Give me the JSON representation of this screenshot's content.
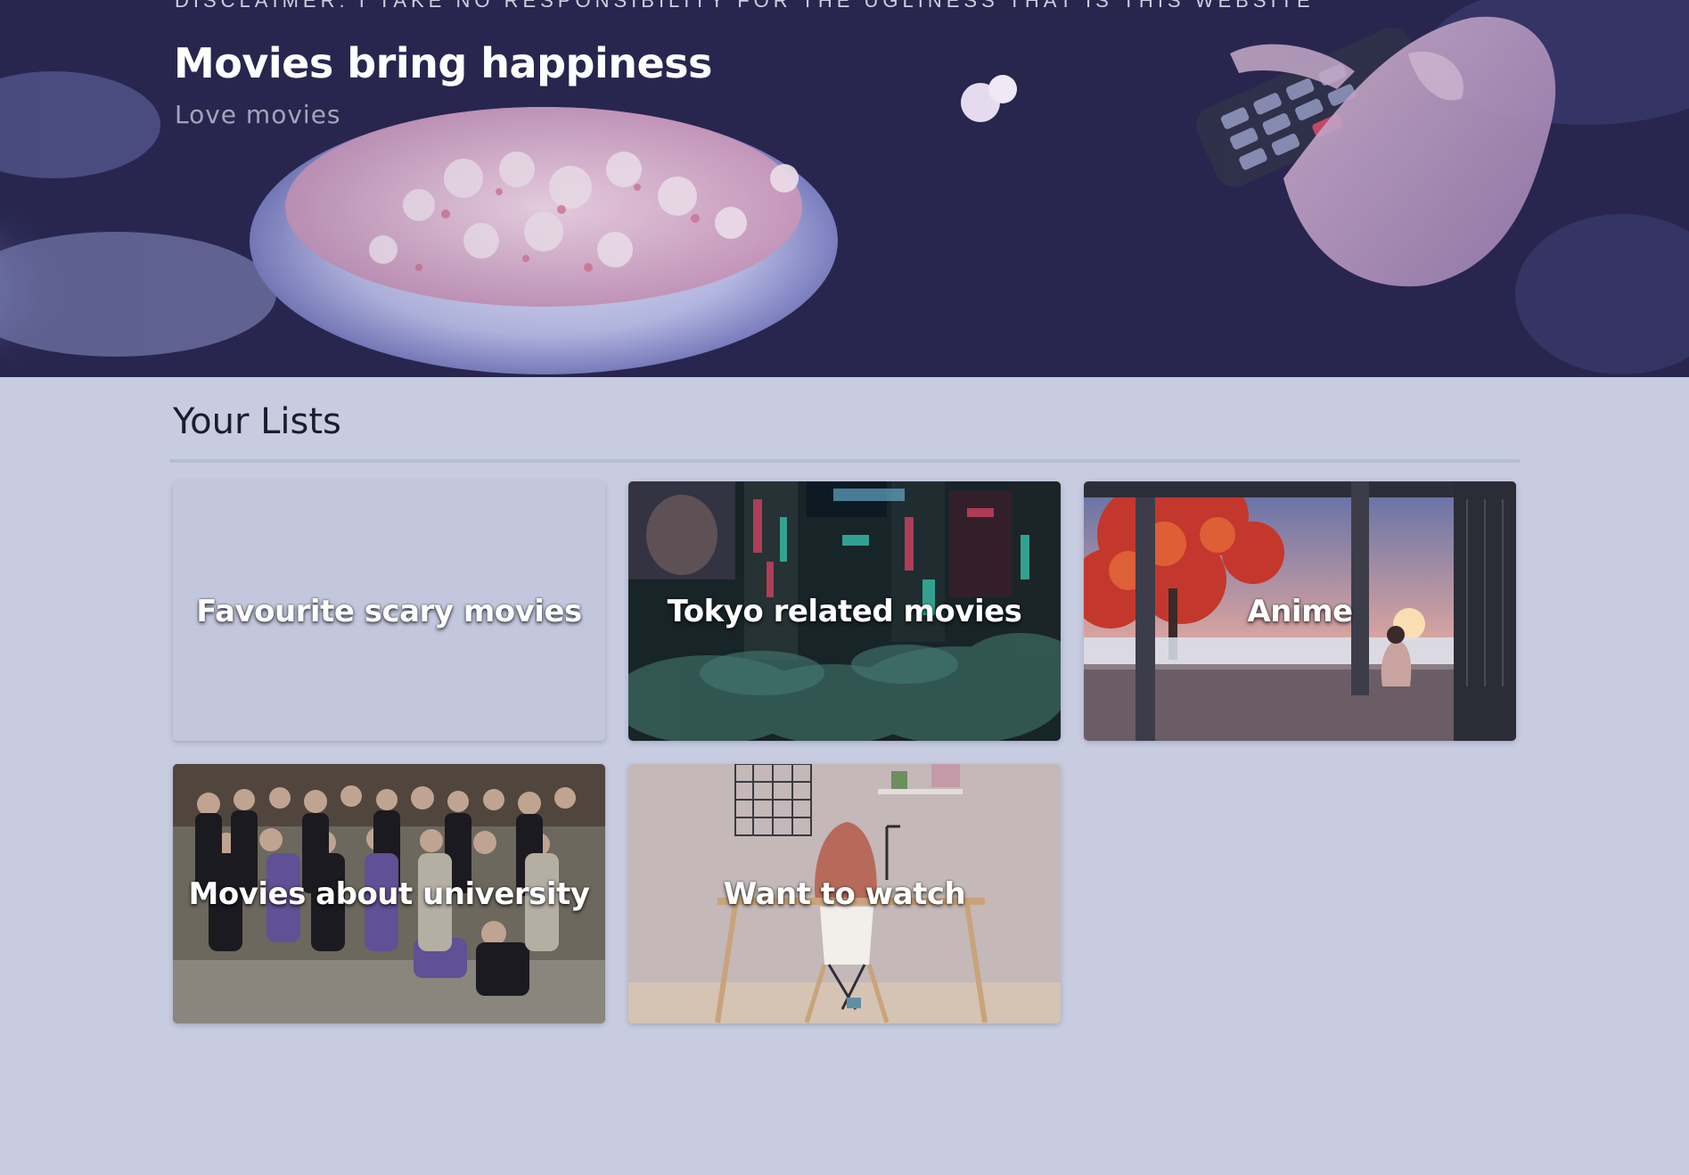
{
  "hero": {
    "disclaimer": "DISCLAIMER: I TAKE NO RESPONSIBILITY FOR THE UGLINESS THAT IS THIS WEBSITE",
    "title": "Movies bring happiness",
    "subtitle": "Love movies"
  },
  "lists": {
    "heading": "Your Lists",
    "items": [
      {
        "label": "Favourite scary movies"
      },
      {
        "label": "Tokyo related movies"
      },
      {
        "label": "Anime"
      },
      {
        "label": "Movies about university"
      },
      {
        "label": "Want to watch"
      }
    ]
  },
  "colors": {
    "page_background": "#c7cce0",
    "hero_tint": "#2a2850",
    "heading_text": "#1c1c2e",
    "card_label": "#ffffff"
  }
}
